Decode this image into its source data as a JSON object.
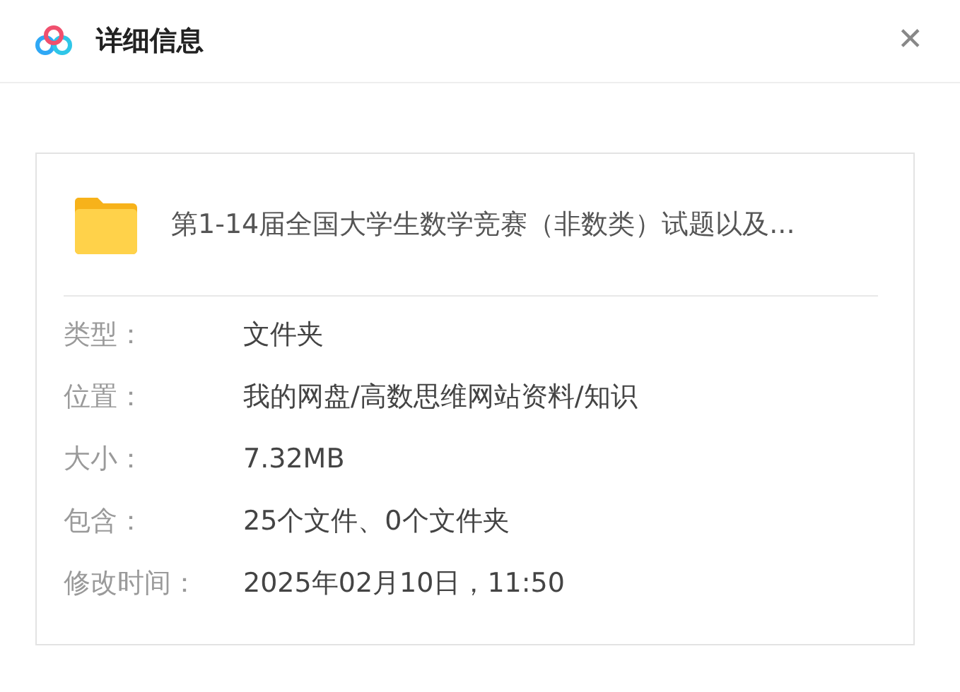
{
  "window": {
    "title": "详细信息",
    "close": "✕"
  },
  "item": {
    "name": "第1-14届全国大学生数学竞赛（非数类）试题以及..."
  },
  "properties": [
    {
      "label": "类型：",
      "value": "文件夹"
    },
    {
      "label": "位置：",
      "value": "我的网盘/高数思维网站资料/知识"
    },
    {
      "label": "大小：",
      "value": "7.32MB"
    },
    {
      "label": "包含：",
      "value": "25个文件、0个文件夹"
    },
    {
      "label": "修改时间：",
      "value": "2025年02月10日，11:50"
    }
  ]
}
